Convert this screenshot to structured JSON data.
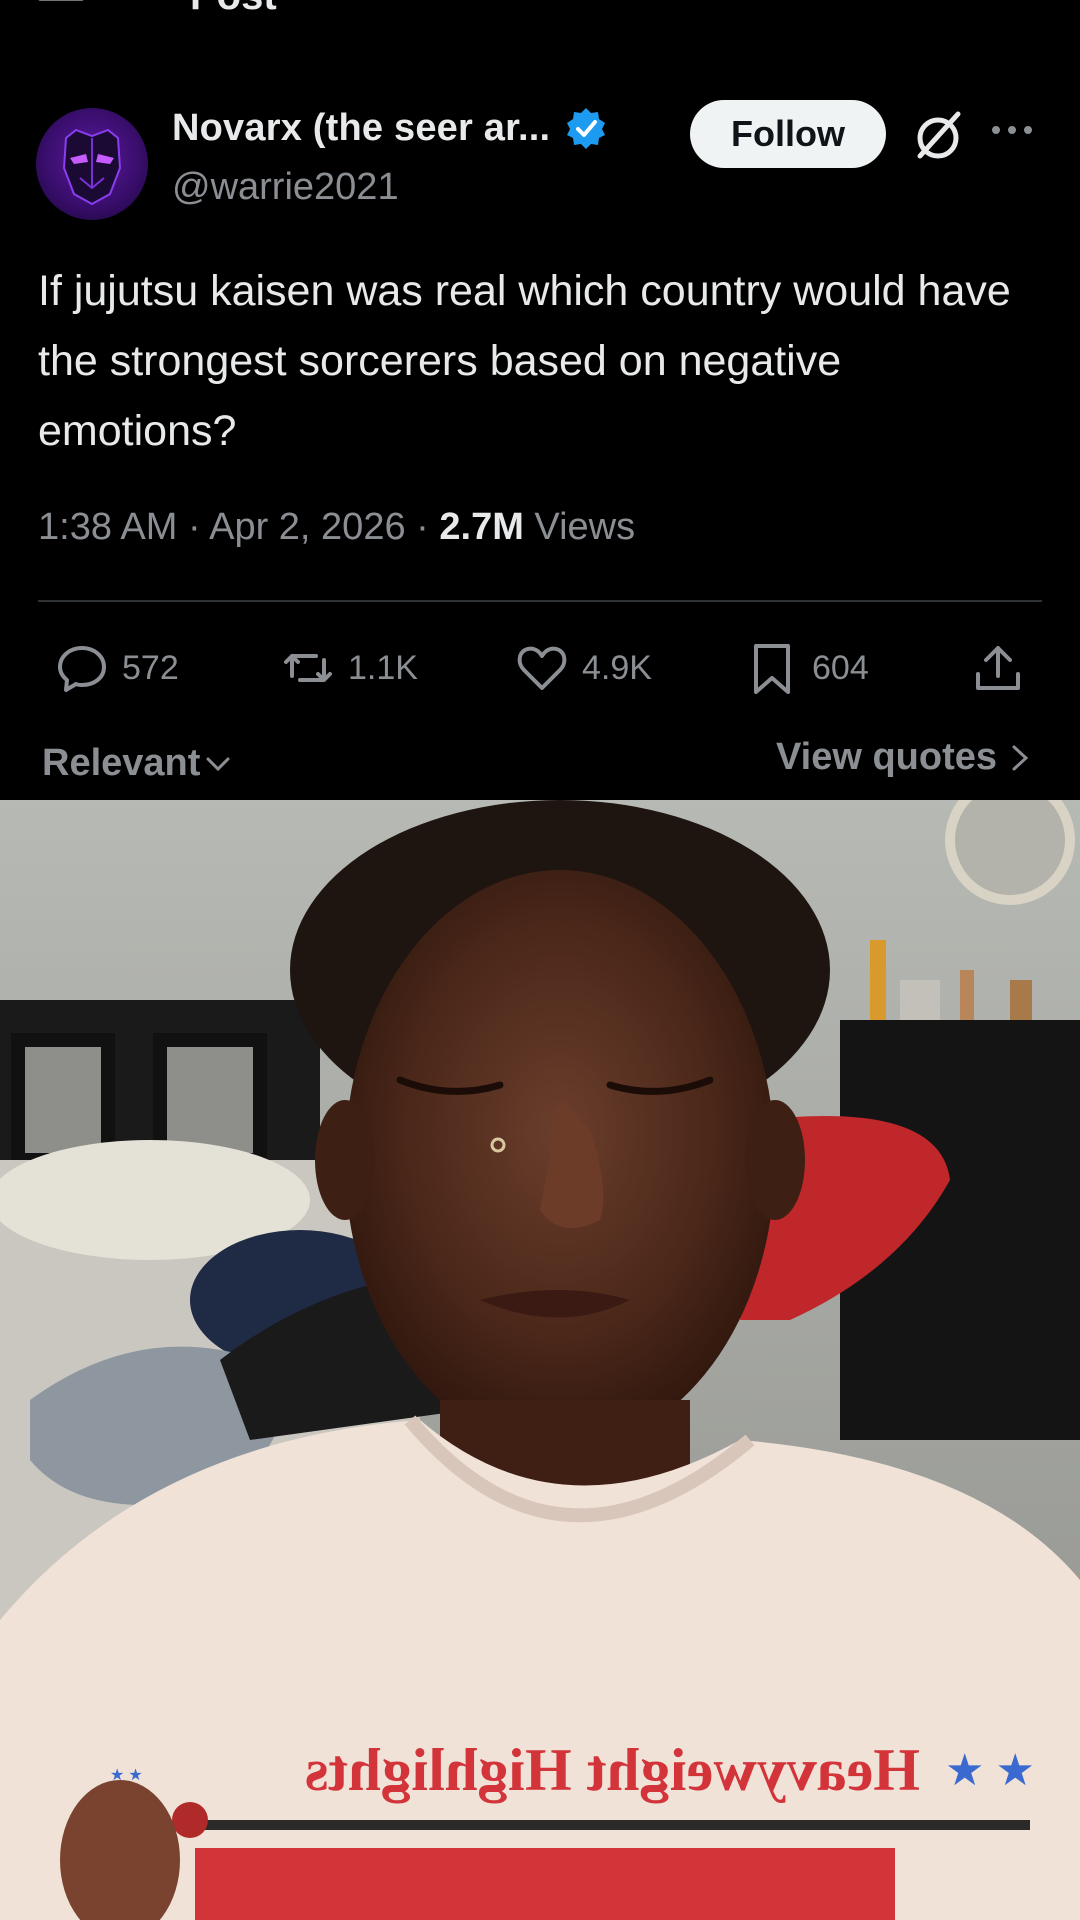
{
  "topbar": {
    "title": "Post"
  },
  "author": {
    "display_name": "Novarx (the seer ar...",
    "handle": "@warrie2021"
  },
  "follow_button": {
    "label": "Follow"
  },
  "tweet": {
    "text": "If jujutsu kaisen was real which country would have the strongest sorcerers based on negative emotions?"
  },
  "meta": {
    "time": "1:38 AM",
    "date": "Apr 2, 2026",
    "views_count": "2.7M",
    "views_label": "Views",
    "separator": " · "
  },
  "actions": {
    "replies": "572",
    "reposts": "1.1K",
    "likes": "4.9K",
    "bookmarks": "604"
  },
  "filters": {
    "sort_label": "Relevant",
    "quotes_label": "View quotes"
  },
  "video": {
    "shirt_text": "Heavyweight Highlights"
  },
  "colors": {
    "background": "#000000",
    "text_primary": "#e7e9ea",
    "text_secondary": "#8b8f94",
    "verified_blue": "#1d9bf0",
    "follow_bg": "#eff3f4"
  }
}
